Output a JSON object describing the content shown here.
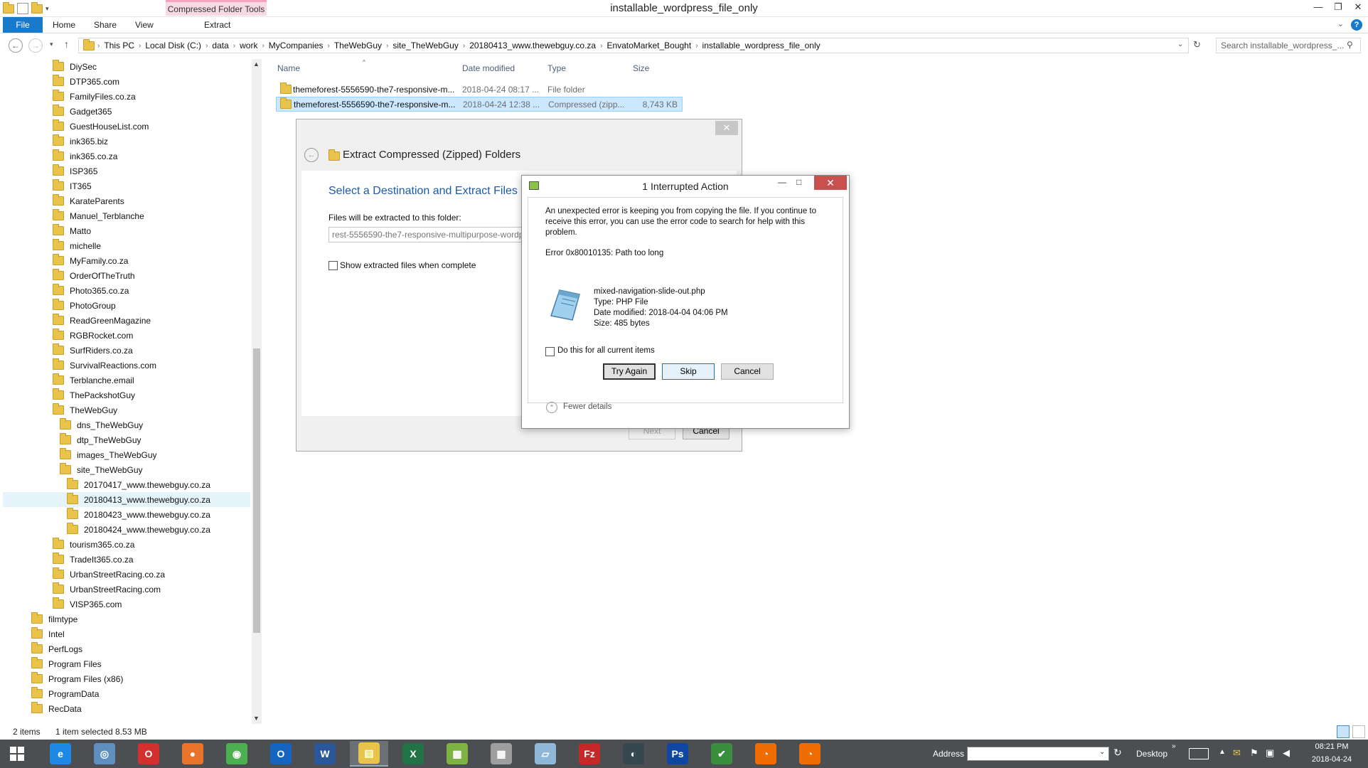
{
  "window": {
    "title": "installable_wordpress_file_only",
    "context_tab_header": "Compressed Folder Tools",
    "controls": [
      "—",
      "❐",
      "✕"
    ]
  },
  "ribbon": {
    "tabs": [
      "File",
      "Home",
      "Share",
      "View",
      "Extract"
    ]
  },
  "address": {
    "crumbs": [
      "This PC",
      "Local Disk (C:)",
      "data",
      "work",
      "MyCompanies",
      "TheWebGuy",
      "site_TheWebGuy",
      "20180413_www.thewebguy.co.za",
      "EnvatoMarket_Bought",
      "installable_wordpress_file_only"
    ],
    "search_placeholder": "Search installable_wordpress_..."
  },
  "nav_tree": [
    {
      "label": "DiySec",
      "indent": 1
    },
    {
      "label": "DTP365.com",
      "indent": 1
    },
    {
      "label": "FamilyFiles.co.za",
      "indent": 1
    },
    {
      "label": "Gadget365",
      "indent": 1
    },
    {
      "label": "GuestHouseList.com",
      "indent": 1
    },
    {
      "label": "ink365.biz",
      "indent": 1
    },
    {
      "label": "ink365.co.za",
      "indent": 1
    },
    {
      "label": "ISP365",
      "indent": 1
    },
    {
      "label": "IT365",
      "indent": 1
    },
    {
      "label": "KarateParents",
      "indent": 1
    },
    {
      "label": "Manuel_Terblanche",
      "indent": 1
    },
    {
      "label": "Matto",
      "indent": 1
    },
    {
      "label": "michelle",
      "indent": 1
    },
    {
      "label": "MyFamily.co.za",
      "indent": 1
    },
    {
      "label": "OrderOfTheTruth",
      "indent": 1
    },
    {
      "label": "Photo365.co.za",
      "indent": 1
    },
    {
      "label": "PhotoGroup",
      "indent": 1
    },
    {
      "label": "ReadGreenMagazine",
      "indent": 1
    },
    {
      "label": "RGBRocket.com",
      "indent": 1
    },
    {
      "label": "SurfRiders.co.za",
      "indent": 1
    },
    {
      "label": "SurvivalReactions.com",
      "indent": 1
    },
    {
      "label": "Terblanche.email",
      "indent": 1
    },
    {
      "label": "ThePackshotGuy",
      "indent": 1
    },
    {
      "label": "TheWebGuy",
      "indent": 1
    },
    {
      "label": "dns_TheWebGuy",
      "indent": 2
    },
    {
      "label": "dtp_TheWebGuy",
      "indent": 2
    },
    {
      "label": "images_TheWebGuy",
      "indent": 2
    },
    {
      "label": "site_TheWebGuy",
      "indent": 2
    },
    {
      "label": "20170417_www.thewebguy.co.za",
      "indent": 3
    },
    {
      "label": "20180413_www.thewebguy.co.za",
      "indent": 3,
      "selected": true
    },
    {
      "label": "20180423_www.thewebguy.co.za",
      "indent": 3
    },
    {
      "label": "20180424_www.thewebguy.co.za",
      "indent": 3
    },
    {
      "label": "tourism365.co.za",
      "indent": 1
    },
    {
      "label": "TradeIt365.co.za",
      "indent": 1
    },
    {
      "label": "UrbanStreetRacing.co.za",
      "indent": 1
    },
    {
      "label": "UrbanStreetRacing.com",
      "indent": 1
    },
    {
      "label": "VISP365.com",
      "indent": 1
    },
    {
      "label": "filmtype",
      "indent": 0
    },
    {
      "label": "Intel",
      "indent": 0
    },
    {
      "label": "PerfLogs",
      "indent": 0
    },
    {
      "label": "Program Files",
      "indent": 0
    },
    {
      "label": "Program Files (x86)",
      "indent": 0
    },
    {
      "label": "ProgramData",
      "indent": 0
    },
    {
      "label": "RecData",
      "indent": 0
    }
  ],
  "file_list": {
    "columns": [
      "Name",
      "Date modified",
      "Type",
      "Size"
    ],
    "rows": [
      {
        "name": "themeforest-5556590-the7-responsive-m...",
        "date": "2018-04-24 08:17 ...",
        "type": "File folder",
        "size": ""
      },
      {
        "name": "themeforest-5556590-the7-responsive-m...",
        "date": "2018-04-24 12:38 ...",
        "type": "Compressed (zipp...",
        "size": "8,743 KB"
      }
    ]
  },
  "wizard": {
    "title": "Extract Compressed (Zipped) Folders",
    "heading": "Select a Destination and Extract Files",
    "dest_label": "Files will be extracted to this folder:",
    "dest_value": "rest-5556590-the7-responsive-multipurpose-wordp",
    "checkbox_label": "Show extracted files when complete",
    "next_label": "Next",
    "cancel_label": "Cancel"
  },
  "dialog": {
    "title": "1 Interrupted Action",
    "message": "An unexpected error is keeping you from copying the file. If you continue to receive this error, you can use the error code to search for help with this problem.",
    "error": "Error 0x80010135: Path too long",
    "file_name": "mixed-navigation-slide-out.php",
    "file_type": "Type: PHP File",
    "file_date": "Date modified: 2018-04-04 04:06 PM",
    "file_size": "Size: 485 bytes",
    "checkbox_label": "Do this for all current items",
    "try_again": "Try Again",
    "skip": "Skip",
    "cancel": "Cancel",
    "fewer_details": "Fewer details"
  },
  "status": {
    "items": "2 items",
    "selected": "1 item selected  8.53 MB"
  },
  "taskbar": {
    "address_label": "Address",
    "desktop_label": "Desktop",
    "time": "08:21 PM",
    "date": "2018-04-24",
    "apps": [
      {
        "name": "internet-explorer",
        "color": "#1e88e5",
        "glyph": "e"
      },
      {
        "name": "safari",
        "color": "#5f8fbf",
        "glyph": "◎"
      },
      {
        "name": "opera",
        "color": "#d32f2f",
        "glyph": "O"
      },
      {
        "name": "firefox",
        "color": "#e8742b",
        "glyph": "●"
      },
      {
        "name": "chrome",
        "color": "#4caf50",
        "glyph": "◉"
      },
      {
        "name": "outlook",
        "color": "#1565c0",
        "glyph": "O"
      },
      {
        "name": "word",
        "color": "#2b579a",
        "glyph": "W"
      },
      {
        "name": "file-explorer",
        "color": "#e8c44a",
        "glyph": "▤"
      },
      {
        "name": "excel",
        "color": "#217346",
        "glyph": "X"
      },
      {
        "name": "game",
        "color": "#7cb342",
        "glyph": "▦"
      },
      {
        "name": "calculator",
        "color": "#9e9e9e",
        "glyph": "▦"
      },
      {
        "name": "notepad",
        "color": "#8fb8d8",
        "glyph": "▱"
      },
      {
        "name": "filezilla",
        "color": "#c62828",
        "glyph": "Fz"
      },
      {
        "name": "media-player",
        "color": "#37474f",
        "glyph": "◐"
      },
      {
        "name": "photoshop",
        "color": "#0d47a1",
        "glyph": "Ps"
      },
      {
        "name": "greenshot",
        "color": "#388e3c",
        "glyph": "✔"
      },
      {
        "name": "orange-app-1",
        "color": "#ef6c00",
        "glyph": "◔"
      },
      {
        "name": "orange-app-2",
        "color": "#ef6c00",
        "glyph": "◔"
      }
    ]
  }
}
